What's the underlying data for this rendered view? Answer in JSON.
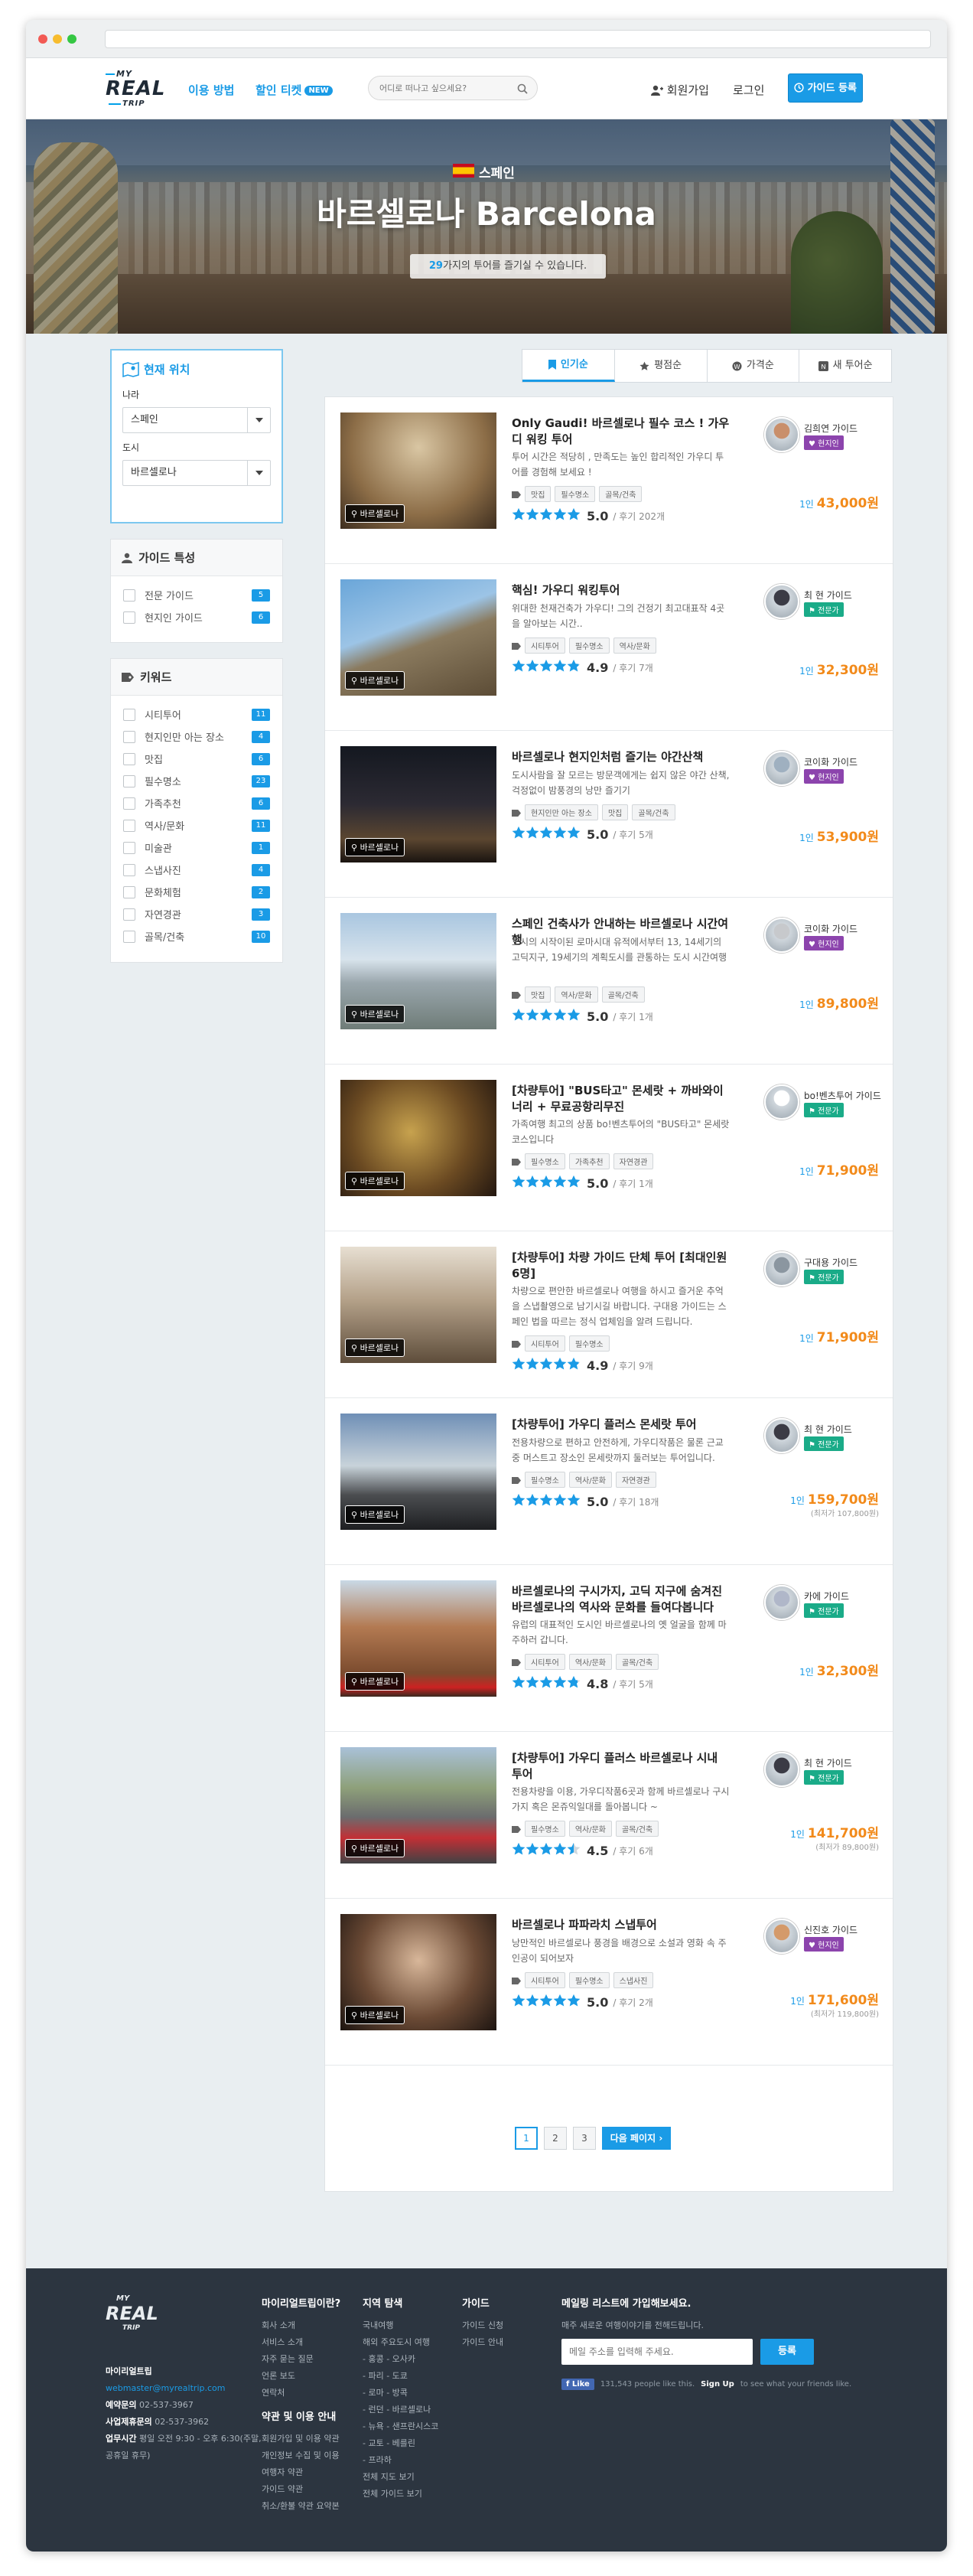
{
  "nav": {
    "logo": {
      "top": "MY",
      "mid": "REAL",
      "bottom": "TRIP"
    },
    "how_to": "이용 방법",
    "discount": "할인 티켓",
    "new_badge": "NEW",
    "search_placeholder": "어디로 떠나고 싶으세요?",
    "signup": "회원가입",
    "login": "로그인",
    "guide_register": "가이드 등록"
  },
  "hero": {
    "country": "스페인",
    "city": "바르셀로나 Barcelona",
    "tour_count": "29",
    "subtitle_rest": "가지의 투어를 즐기실 수 있습니다."
  },
  "location": {
    "title": "현재 위치",
    "country_label": "나라",
    "country_value": "스페인",
    "city_label": "도시",
    "city_value": "바르셀로나"
  },
  "guide_type": {
    "title": "가이드 특성",
    "items": [
      {
        "label": "전문 가이드",
        "count": "5"
      },
      {
        "label": "현지인 가이드",
        "count": "6"
      }
    ]
  },
  "keywords": {
    "title": "키워드",
    "items": [
      {
        "label": "시티투어",
        "count": "11"
      },
      {
        "label": "현지인만 아는 장소",
        "count": "4"
      },
      {
        "label": "맛집",
        "count": "6"
      },
      {
        "label": "필수명소",
        "count": "23"
      },
      {
        "label": "가족추천",
        "count": "6"
      },
      {
        "label": "역사/문화",
        "count": "11"
      },
      {
        "label": "미술관",
        "count": "1"
      },
      {
        "label": "스냅사진",
        "count": "4"
      },
      {
        "label": "문화체험",
        "count": "2"
      },
      {
        "label": "자연경관",
        "count": "3"
      },
      {
        "label": "골목/건축",
        "count": "10"
      }
    ]
  },
  "sort_tabs": [
    "인기순",
    "평점순",
    "가격순",
    "새 투어순"
  ],
  "tours": [
    {
      "title": "Only Gaudi! 바르셀로나 필수 코스 ! 가우디 워킹 투어",
      "desc": "투어 시간은 적당히 , 만족도는 높인 합리적인 가우디 투어를 경험해 보세요 !",
      "tags": [
        "맛집",
        "필수명소",
        "골목/건축"
      ],
      "rating": 5,
      "score": "5.0",
      "reviews": "/ 후기 202개",
      "location": "바르셀로나",
      "guide": "김희연 가이드",
      "badge": "현지인",
      "badge_type": "local",
      "per": "1인",
      "price": "43,000원",
      "regular": ""
    },
    {
      "title": "핵심! 가우디 워킹투어",
      "desc": "위대한 천재건축가 가우디! 그의 건정기 최고대표작 4곳을 알아보는 시간..",
      "tags": [
        "시티투어",
        "필수명소",
        "역사/문화"
      ],
      "rating": 4.9,
      "score": "4.9",
      "reviews": "/ 후기 7개",
      "location": "바르셀로나",
      "guide": "최 현 가이드",
      "badge": "전문가",
      "badge_type": "pro",
      "per": "1인",
      "price": "32,300원",
      "regular": ""
    },
    {
      "title": "바르셀로나 현지인처럼 즐기는 야간산책",
      "desc": "도시사람을 잘 모르는 방문객에게는 쉽지 않은 야간 산책, 걱정없이 밤풍경의 낭만 즐기기",
      "tags": [
        "현지인만 아는 장소",
        "맛집",
        "골목/건축"
      ],
      "rating": 5,
      "score": "5.0",
      "reviews": "/ 후기 5개",
      "location": "바르셀로나",
      "guide": "코이화 가이드",
      "badge": "현지인",
      "badge_type": "local",
      "per": "1인",
      "price": "53,900원",
      "regular": ""
    },
    {
      "title": "스페인 건축사가 안내하는 바르셀로나 시간여행",
      "desc": "도시의 시작이된 로마시대 유적에서부터 13, 14세기의 고딕지구, 19세기의 계획도시를 관통하는 도시 시간여행",
      "tags": [
        "맛집",
        "역사/문화",
        "골목/건축"
      ],
      "rating": 5,
      "score": "5.0",
      "reviews": "/ 후기 1개",
      "location": "바르셀로나",
      "guide": "코이화 가이드",
      "badge": "현지인",
      "badge_type": "local",
      "per": "1인",
      "price": "89,800원",
      "regular": ""
    },
    {
      "title": "[차량투어] \"BUS타고\" 몬세랏 + 까바와이너리 + 무료공항리무진",
      "desc": "가족여행 최고의 상품 bo!벤츠투어의 \"BUS타고\" 몬세랏 코스입니다",
      "tags": [
        "필수명소",
        "가족추천",
        "자연경관"
      ],
      "rating": 5,
      "score": "5.0",
      "reviews": "/ 후기 1개",
      "location": "바르셀로나",
      "guide": "bo!벤츠투어 가이드",
      "badge": "전문가",
      "badge_type": "pro",
      "per": "1인",
      "price": "71,900원",
      "regular": ""
    },
    {
      "title": "[차량투어] 차량 가이드 단체 투어 [최대인원 6명]",
      "desc": "차량으로 편안한 바르셀로나 여행을 하시고 즐거운 추억을 스냅촬영으로 남기시길 바랍니다. 구대용 가이드는 스페인 법을 따르는 정식 업체임을 알려 드립니다.",
      "tags": [
        "시티투어",
        "필수명소"
      ],
      "rating": 4.9,
      "score": "4.9",
      "reviews": "/ 후기 9개",
      "location": "바르셀로나",
      "guide": "구대용 가이드",
      "badge": "전문가",
      "badge_type": "pro",
      "per": "1인",
      "price": "71,900원",
      "regular": ""
    },
    {
      "title": "[차량투어] 가우디 플러스 몬세랏 투어",
      "desc": "전용차량으로 편하고 안전하게, 가우디작품은 물론 근교중 머스트고 장소인 몬세랏까지 둘러보는 투어입니다.",
      "tags": [
        "필수명소",
        "역사/문화",
        "자연경관"
      ],
      "rating": 5,
      "score": "5.0",
      "reviews": "/ 후기 18개",
      "location": "바르셀로나",
      "guide": "최 현 가이드",
      "badge": "전문가",
      "badge_type": "pro",
      "per": "1인",
      "price": "159,700원",
      "regular": "(최저가 107,800원)"
    },
    {
      "title": "바르셀로나의 구시가지, 고딕 지구에 숨겨진 바르셀로나의 역사와 문화를 들여다봅니다",
      "desc": "유럽의 대표적인 도시인 바르셀로나의 옛 얼굴을 함께 마주하러 갑니다.",
      "tags": [
        "시티투어",
        "역사/문화",
        "골목/건축"
      ],
      "rating": 4.8,
      "score": "4.8",
      "reviews": "/ 후기 5개",
      "location": "바르셀로나",
      "guide": "카에 가이드",
      "badge": "전문가",
      "badge_type": "pro",
      "per": "1인",
      "price": "32,300원",
      "regular": ""
    },
    {
      "title": "[차량투어] 가우디 플러스 바르셀로나 시내 투어",
      "desc": "전용차량을 이용, 가우디작품6곳과 함께 바르셀로나 구시가지 혹은 몬쥬익일대를 돌아봅니다 ~",
      "tags": [
        "필수명소",
        "역사/문화",
        "골목/건축"
      ],
      "rating": 4.5,
      "score": "4.5",
      "reviews": "/ 후기 6개",
      "location": "바르셀로나",
      "guide": "최 현 가이드",
      "badge": "전문가",
      "badge_type": "pro",
      "per": "1인",
      "price": "141,700원",
      "regular": "(최저가 89,800원)"
    },
    {
      "title": "바르셀로나 파파라치 스냅투어",
      "desc": "낭만적인 바르셀로나 풍경을 배경으로 소설과 영화 속 주인공이 되어보자",
      "tags": [
        "시티투어",
        "필수명소",
        "스냅사진"
      ],
      "rating": 5,
      "score": "5.0",
      "reviews": "/ 후기 2개",
      "location": "바르셀로나",
      "guide": "신진호 가이드",
      "badge": "현지인",
      "badge_type": "local",
      "per": "1인",
      "price": "171,600원",
      "regular": "(최저가 119,800원)"
    }
  ],
  "pagination": {
    "pages": [
      "1",
      "2",
      "3"
    ],
    "current": "1",
    "next": "다음 페이지"
  },
  "footer": {
    "company": "마이리얼트립",
    "email": "webmaster@myrealtrip.com",
    "phone_label": "예약문의",
    "phone": "02-537-3967",
    "biz_label": "사업제휴문의",
    "biz_phone": "02-537-3962",
    "hours_label": "업무시간",
    "hours": "평일 오전 9:30 - 오후 6:30(주말,",
    "holiday": "공휴일 휴무)",
    "col1_title": "마이리얼트립이란?",
    "col1": [
      "회사 소개",
      "서비스 소개",
      "자주 묻는 질문",
      "언론 보도",
      "연락처"
    ],
    "col1b_title": "약관 및 이용 안내",
    "col1b": [
      "회원가입 및 이용 약관",
      "개인정보 수집 및 이용",
      "여행자 약관",
      "가이드 약관",
      "취소/환불 약관 요약본"
    ],
    "col2_title": "지역 탐색",
    "col2": [
      "국내여행",
      "해외 주요도시 여행",
      "- 홍콩  - 오사카",
      "- 파리  - 도쿄",
      "- 로마  - 방콕",
      "- 런던  - 바르셀로나",
      "- 뉴욕  - 샌프란시스코",
      "- 교토  - 베를린",
      "- 프라하",
      "전체 지도 보기",
      "전체 가이드 보기"
    ],
    "col3_title": "가이드",
    "col3": [
      "가이드 신청",
      "가이드 안내"
    ],
    "news_title": "메일링 리스트에 가입해보세요.",
    "news_sub": "매주 새로운 여행이야기를 전해드립니다.",
    "email_placeholder": "메일 주소를 입력해 주세요.",
    "subscribe": "등록",
    "fb_like": "Like",
    "fb_text": "131,543 people like this.",
    "fb_signup": "Sign Up",
    "fb_rest": "to see what your friends like."
  },
  "colors": {
    "accent": "#1a9be6",
    "price": "#f28a1a",
    "local_badge": "#8c44ad",
    "pro_badge": "#1aab88",
    "footer_bg": "#2c3540"
  }
}
